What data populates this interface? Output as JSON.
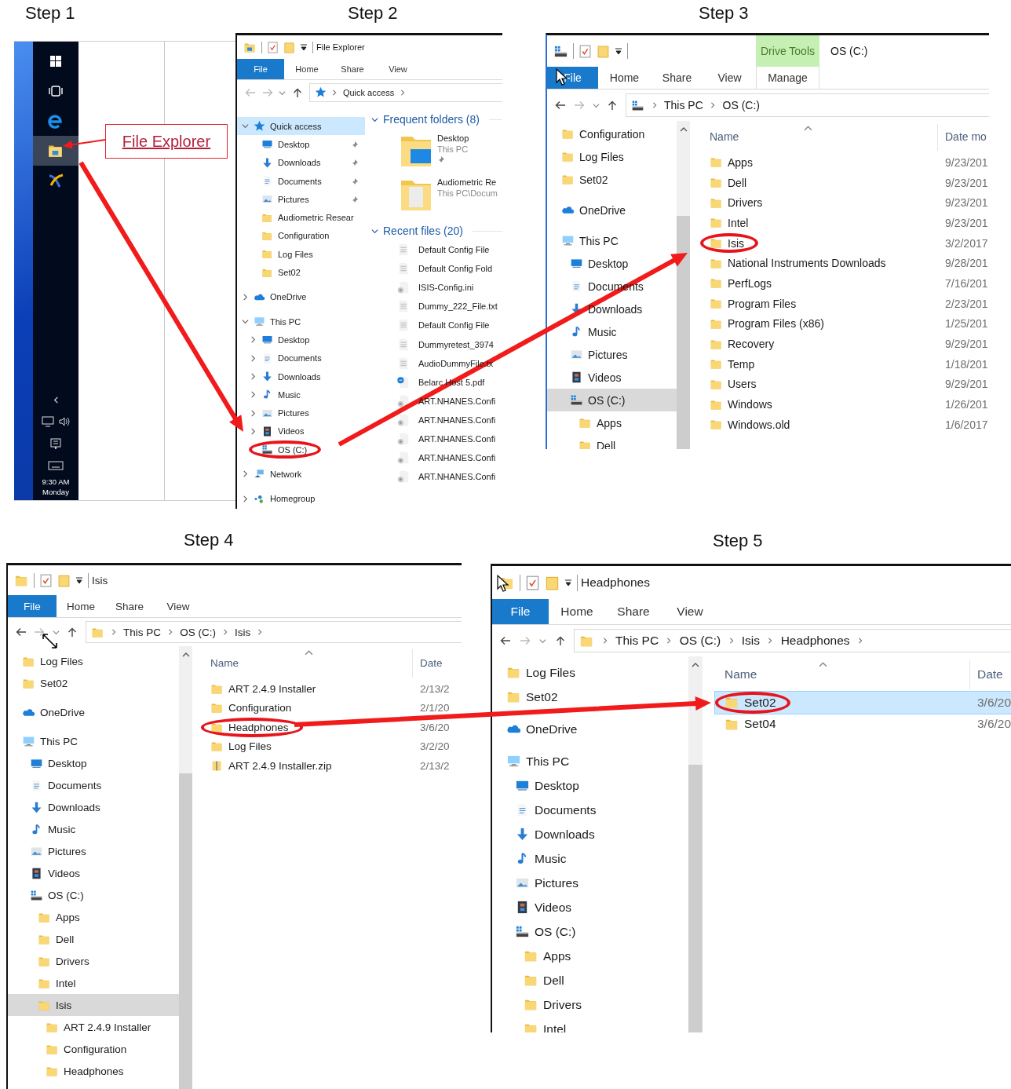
{
  "steps": [
    {
      "label": "Step 1",
      "kind": "taskbar",
      "callout": "File Explorer",
      "apps": [
        {
          "kind": "start",
          "selected": false
        },
        {
          "kind": "taskview",
          "selected": false
        },
        {
          "kind": "browser",
          "selected": false
        },
        {
          "kind": "explorer",
          "selected": true
        },
        {
          "kind": "app",
          "selected": false
        }
      ],
      "clock": {
        "time": "9:30 AM",
        "day": "Monday"
      }
    },
    {
      "label": "Step 2",
      "kind": "explorer",
      "window": {
        "title": "File Explorer",
        "ribbon": {
          "tabs": [
            {
              "label": "File",
              "kind": "file"
            },
            {
              "label": "Home",
              "kind": "tab"
            },
            {
              "label": "Share",
              "kind": "tab"
            },
            {
              "label": "View",
              "kind": "tab"
            }
          ]
        },
        "address": {
          "path": [
            "Quick access"
          ],
          "trailing_chevron": true,
          "back_enabled": false,
          "forward_enabled": false
        },
        "nav": [
          {
            "label": "Quick access",
            "kind": "quickaccess",
            "expanded": true,
            "selected": true,
            "circled": false,
            "children": [
              {
                "label": "Desktop",
                "kind": "desktop",
                "pinned": true,
                "selected": false,
                "circled": false
              },
              {
                "label": "Downloads",
                "kind": "downloads",
                "pinned": true,
                "selected": false,
                "circled": false
              },
              {
                "label": "Documents",
                "kind": "documents",
                "pinned": true,
                "selected": false,
                "circled": false
              },
              {
                "label": "Pictures",
                "kind": "pictures",
                "pinned": true,
                "selected": false,
                "circled": false
              },
              {
                "label": "Audiometric Resear",
                "kind": "folder",
                "pinned": false,
                "selected": false,
                "circled": false
              },
              {
                "label": "Configuration",
                "kind": "folder",
                "pinned": false,
                "selected": false,
                "circled": false
              },
              {
                "label": "Log Files",
                "kind": "folder",
                "pinned": false,
                "selected": false,
                "circled": false
              },
              {
                "label": "Set02",
                "kind": "folder",
                "pinned": false,
                "selected": false,
                "circled": false
              }
            ]
          },
          {
            "label": "OneDrive",
            "kind": "onedrive",
            "expanded": false,
            "selected": false,
            "circled": false
          },
          {
            "label": "This PC",
            "kind": "thispc",
            "expanded": true,
            "selected": false,
            "circled": false,
            "children": [
              {
                "label": "Desktop",
                "kind": "desktop",
                "expanded": false,
                "selected": false,
                "circled": false
              },
              {
                "label": "Documents",
                "kind": "documents",
                "expanded": false,
                "selected": false,
                "circled": false
              },
              {
                "label": "Downloads",
                "kind": "downloads",
                "expanded": false,
                "selected": false,
                "circled": false
              },
              {
                "label": "Music",
                "kind": "music",
                "expanded": false,
                "selected": false,
                "circled": false
              },
              {
                "label": "Pictures",
                "kind": "pictures",
                "expanded": false,
                "selected": false,
                "circled": false
              },
              {
                "label": "Videos",
                "kind": "videos",
                "expanded": false,
                "selected": false,
                "circled": false
              },
              {
                "label": "OS (C:)",
                "kind": "drive",
                "selected": false,
                "circled": true
              }
            ]
          },
          {
            "label": "Network",
            "kind": "network",
            "expanded": false,
            "selected": false,
            "circled": false
          },
          {
            "label": "Homegroup",
            "kind": "homegroup",
            "expanded": false,
            "selected": false,
            "circled": false
          }
        ],
        "content": {
          "kind": "quick_access",
          "sections": [
            {
              "title": "Frequent folders (8)",
              "kind": "tiles",
              "items": [
                {
                  "name": "Desktop",
                  "sub": "This PC",
                  "kind": "desktop",
                  "pinned": true
                },
                {
                  "name": "Audiometric Re",
                  "sub": "This PC\\Docum",
                  "kind": "documents",
                  "pinned": false
                }
              ]
            },
            {
              "title": "Recent files (20)",
              "kind": "files",
              "items": [
                {
                  "name": "Default Config File",
                  "kind": "text"
                },
                {
                  "name": "Default Config Fold",
                  "kind": "text"
                },
                {
                  "name": "ISIS-Config.ini",
                  "kind": "config"
                },
                {
                  "name": "Dummy_222_File.txt",
                  "kind": "text"
                },
                {
                  "name": "Default Config File",
                  "kind": "text"
                },
                {
                  "name": "Dummyretest_3974",
                  "kind": "text"
                },
                {
                  "name": "AudioDummyFile.tx",
                  "kind": "text"
                },
                {
                  "name": "Belarc Host 5.pdf",
                  "kind": "pdf"
                },
                {
                  "name": "ART.NHANES.Confi",
                  "kind": "config"
                },
                {
                  "name": "ART.NHANES.Confi",
                  "kind": "config"
                },
                {
                  "name": "ART.NHANES.Confi",
                  "kind": "config"
                },
                {
                  "name": "ART.NHANES.Confi",
                  "kind": "config"
                },
                {
                  "name": "ART.NHANES.Confi",
                  "kind": "config"
                }
              ]
            }
          ]
        }
      }
    },
    {
      "label": "Step 3",
      "kind": "explorer",
      "window": {
        "title": "OS (C:)",
        "ribbon": {
          "tabs": [
            {
              "label": "File",
              "kind": "file"
            },
            {
              "label": "Home",
              "kind": "tab"
            },
            {
              "label": "Share",
              "kind": "tab"
            },
            {
              "label": "View",
              "kind": "tab"
            },
            {
              "label": "Manage",
              "kind": "contextual",
              "group": "Drive Tools"
            }
          ]
        },
        "address": {
          "path": [
            "This PC",
            "OS (C:)"
          ],
          "trailing_chevron": false,
          "back_enabled": true,
          "forward_enabled": false
        },
        "nav": [
          {
            "children": [
              {
                "label": "Configuration",
                "kind": "folder",
                "selected": false,
                "circled": false
              },
              {
                "label": "Log Files",
                "kind": "folder",
                "selected": false,
                "circled": false
              },
              {
                "label": "Set02",
                "kind": "folder",
                "selected": false,
                "circled": false
              }
            ]
          },
          {
            "label": "OneDrive",
            "kind": "onedrive",
            "selected": false,
            "circled": false
          },
          {
            "label": "This PC",
            "kind": "thispc",
            "selected": false,
            "circled": false,
            "children": [
              {
                "label": "Desktop",
                "kind": "desktop",
                "selected": false,
                "circled": false
              },
              {
                "label": "Documents",
                "kind": "documents",
                "selected": false,
                "circled": false
              },
              {
                "label": "Downloads",
                "kind": "downloads",
                "selected": false,
                "circled": false
              },
              {
                "label": "Music",
                "kind": "music",
                "selected": false,
                "circled": false
              },
              {
                "label": "Pictures",
                "kind": "pictures",
                "selected": false,
                "circled": false
              },
              {
                "label": "Videos",
                "kind": "videos",
                "selected": false,
                "circled": false
              },
              {
                "label": "OS (C:)",
                "kind": "drive",
                "selected": true,
                "circled": false,
                "children": [
                  {
                    "label": "Apps",
                    "kind": "folder",
                    "selected": false,
                    "circled": false
                  },
                  {
                    "label": "Dell",
                    "kind": "folder",
                    "selected": false,
                    "circled": false
                  }
                ]
              }
            ]
          }
        ],
        "content": {
          "kind": "details",
          "columns": [
            "Name",
            "Date mo"
          ],
          "rows": [
            {
              "name": "Apps",
              "date": "9/23/201",
              "kind": "folder",
              "selected": false,
              "circled": false
            },
            {
              "name": "Dell",
              "date": "9/23/201",
              "kind": "folder",
              "selected": false,
              "circled": false
            },
            {
              "name": "Drivers",
              "date": "9/23/201",
              "kind": "folder",
              "selected": false,
              "circled": false
            },
            {
              "name": "Intel",
              "date": "9/23/201",
              "kind": "folder",
              "selected": false,
              "circled": false
            },
            {
              "name": "Isis",
              "date": "3/2/2017",
              "kind": "folder",
              "selected": false,
              "circled": true
            },
            {
              "name": "National Instruments Downloads",
              "date": "9/28/201",
              "kind": "folder",
              "selected": false,
              "circled": false
            },
            {
              "name": "PerfLogs",
              "date": "7/16/201",
              "kind": "folder",
              "selected": false,
              "circled": false
            },
            {
              "name": "Program Files",
              "date": "2/23/201",
              "kind": "folder",
              "selected": false,
              "circled": false
            },
            {
              "name": "Program Files (x86)",
              "date": "1/25/201",
              "kind": "folder",
              "selected": false,
              "circled": false
            },
            {
              "name": "Recovery",
              "date": "9/29/201",
              "kind": "folder",
              "selected": false,
              "circled": false
            },
            {
              "name": "Temp",
              "date": "1/18/201",
              "kind": "folder",
              "selected": false,
              "circled": false
            },
            {
              "name": "Users",
              "date": "9/29/201",
              "kind": "folder",
              "selected": false,
              "circled": false
            },
            {
              "name": "Windows",
              "date": "1/26/201",
              "kind": "folder",
              "selected": false,
              "circled": false
            },
            {
              "name": "Windows.old",
              "date": "1/6/2017",
              "kind": "folder",
              "selected": false,
              "circled": false
            }
          ]
        }
      }
    },
    {
      "label": "Step 4",
      "kind": "explorer",
      "window": {
        "title": "Isis",
        "ribbon": {
          "tabs": [
            {
              "label": "File",
              "kind": "file"
            },
            {
              "label": "Home",
              "kind": "tab"
            },
            {
              "label": "Share",
              "kind": "tab"
            },
            {
              "label": "View",
              "kind": "tab"
            }
          ]
        },
        "address": {
          "path": [
            "This PC",
            "OS (C:)",
            "Isis"
          ],
          "trailing_chevron": true,
          "back_enabled": true,
          "forward_enabled": false
        },
        "nav": [
          {
            "children": [
              {
                "label": "Log Files",
                "kind": "folder",
                "selected": false,
                "circled": false
              },
              {
                "label": "Set02",
                "kind": "folder",
                "selected": false,
                "circled": false
              }
            ]
          },
          {
            "label": "OneDrive",
            "kind": "onedrive",
            "selected": false,
            "circled": false
          },
          {
            "label": "This PC",
            "kind": "thispc",
            "selected": false,
            "circled": false,
            "children": [
              {
                "label": "Desktop",
                "kind": "desktop",
                "selected": false,
                "circled": false
              },
              {
                "label": "Documents",
                "kind": "documents",
                "selected": false,
                "circled": false
              },
              {
                "label": "Downloads",
                "kind": "downloads",
                "selected": false,
                "circled": false
              },
              {
                "label": "Music",
                "kind": "music",
                "selected": false,
                "circled": false
              },
              {
                "label": "Pictures",
                "kind": "pictures",
                "selected": false,
                "circled": false
              },
              {
                "label": "Videos",
                "kind": "videos",
                "selected": false,
                "circled": false
              },
              {
                "label": "OS (C:)",
                "kind": "drive",
                "selected": false,
                "circled": false,
                "children": [
                  {
                    "label": "Apps",
                    "kind": "folder",
                    "selected": false,
                    "circled": false
                  },
                  {
                    "label": "Dell",
                    "kind": "folder",
                    "selected": false,
                    "circled": false
                  },
                  {
                    "label": "Drivers",
                    "kind": "folder",
                    "selected": false,
                    "circled": false
                  },
                  {
                    "label": "Intel",
                    "kind": "folder",
                    "selected": false,
                    "circled": false
                  },
                  {
                    "label": "Isis",
                    "kind": "folder",
                    "selected": true,
                    "circled": false,
                    "children": [
                      {
                        "label": "ART 2.4.9 Installer",
                        "kind": "folder",
                        "selected": false,
                        "circled": false
                      },
                      {
                        "label": "Configuration",
                        "kind": "folder",
                        "selected": false,
                        "circled": false
                      },
                      {
                        "label": "Headphones",
                        "kind": "folder",
                        "selected": false,
                        "circled": false
                      }
                    ]
                  }
                ]
              }
            ]
          }
        ],
        "content": {
          "kind": "details",
          "columns": [
            "Name",
            "Date"
          ],
          "rows": [
            {
              "name": "ART 2.4.9 Installer",
              "date": "2/13/2",
              "kind": "folder",
              "selected": false,
              "circled": false
            },
            {
              "name": "Configuration",
              "date": "2/1/20",
              "kind": "folder",
              "selected": false,
              "circled": false
            },
            {
              "name": "Headphones",
              "date": "3/6/20",
              "kind": "folder",
              "selected": false,
              "circled": true
            },
            {
              "name": "Log Files",
              "date": "3/2/20",
              "kind": "folder",
              "selected": false,
              "circled": false
            },
            {
              "name": "ART 2.4.9 Installer.zip",
              "date": "2/13/2",
              "kind": "zip",
              "selected": false,
              "circled": false
            }
          ]
        }
      }
    },
    {
      "label": "Step 5",
      "kind": "explorer",
      "window": {
        "title": "Headphones",
        "ribbon": {
          "tabs": [
            {
              "label": "File",
              "kind": "file"
            },
            {
              "label": "Home",
              "kind": "tab"
            },
            {
              "label": "Share",
              "kind": "tab"
            },
            {
              "label": "View",
              "kind": "tab"
            }
          ]
        },
        "address": {
          "path": [
            "This PC",
            "OS (C:)",
            "Isis",
            "Headphones"
          ],
          "trailing_chevron": true,
          "back_enabled": true,
          "forward_enabled": false
        },
        "nav": [
          {
            "children": [
              {
                "label": "Log Files",
                "kind": "folder",
                "selected": false,
                "circled": false
              },
              {
                "label": "Set02",
                "kind": "folder",
                "selected": false,
                "circled": false
              }
            ]
          },
          {
            "label": "OneDrive",
            "kind": "onedrive",
            "selected": false,
            "circled": false
          },
          {
            "label": "This PC",
            "kind": "thispc",
            "selected": false,
            "circled": false,
            "children": [
              {
                "label": "Desktop",
                "kind": "desktop",
                "selected": false,
                "circled": false
              },
              {
                "label": "Documents",
                "kind": "documents",
                "selected": false,
                "circled": false
              },
              {
                "label": "Downloads",
                "kind": "downloads",
                "selected": false,
                "circled": false
              },
              {
                "label": "Music",
                "kind": "music",
                "selected": false,
                "circled": false
              },
              {
                "label": "Pictures",
                "kind": "pictures",
                "selected": false,
                "circled": false
              },
              {
                "label": "Videos",
                "kind": "videos",
                "selected": false,
                "circled": false
              },
              {
                "label": "OS (C:)",
                "kind": "drive",
                "selected": false,
                "circled": false,
                "children": [
                  {
                    "label": "Apps",
                    "kind": "folder",
                    "selected": false,
                    "circled": false
                  },
                  {
                    "label": "Dell",
                    "kind": "folder",
                    "selected": false,
                    "circled": false
                  },
                  {
                    "label": "Drivers",
                    "kind": "folder",
                    "selected": false,
                    "circled": false
                  },
                  {
                    "label": "Intel",
                    "kind": "folder",
                    "selected": false,
                    "circled": false
                  }
                ]
              }
            ]
          }
        ],
        "content": {
          "kind": "details",
          "columns": [
            "Name",
            "Date"
          ],
          "rows": [
            {
              "name": "Set02",
              "date": "3/6/20",
              "kind": "folder",
              "selected": true,
              "circled": true
            },
            {
              "name": "Set04",
              "date": "3/6/20",
              "kind": "folder",
              "selected": false,
              "circled": false
            }
          ]
        }
      }
    }
  ]
}
